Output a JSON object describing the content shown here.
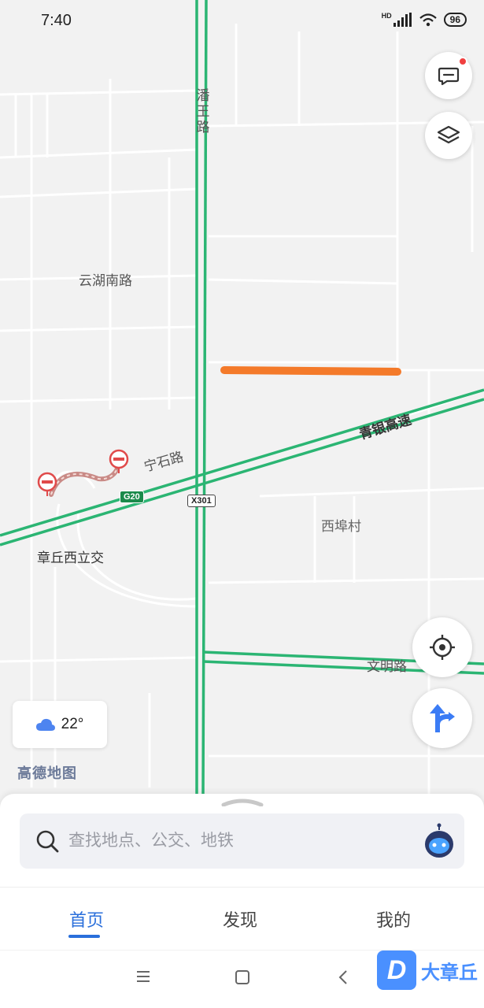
{
  "status": {
    "time": "7:40",
    "network": "HD",
    "battery": "96"
  },
  "map": {
    "labels": {
      "panyu_road": "潘王路",
      "yunhu_south": "云湖南路",
      "ningshi_road": "宁石路",
      "qingyin_expressway": "青银高速",
      "zhangqiu_west": "章丘西立交",
      "xibu_village": "西埠村",
      "wenming_road": "文明路"
    },
    "shields": {
      "g20": "G20",
      "x301": "X301"
    },
    "colors": {
      "expressway": "#2bb573",
      "highlight": "#f47a2a",
      "closed_route": "#c98a86",
      "closure_marker": "#e04a4a"
    }
  },
  "weather": {
    "temp": "22°",
    "icon": "cloud-icon"
  },
  "brand": "高德地图",
  "search": {
    "placeholder": "查找地点、公交、地铁"
  },
  "tabs": [
    {
      "label": "首页",
      "active": true
    },
    {
      "label": "发现",
      "active": false
    },
    {
      "label": "我的",
      "active": false
    }
  ],
  "watermark": {
    "badge": "D",
    "text": "大章丘"
  }
}
